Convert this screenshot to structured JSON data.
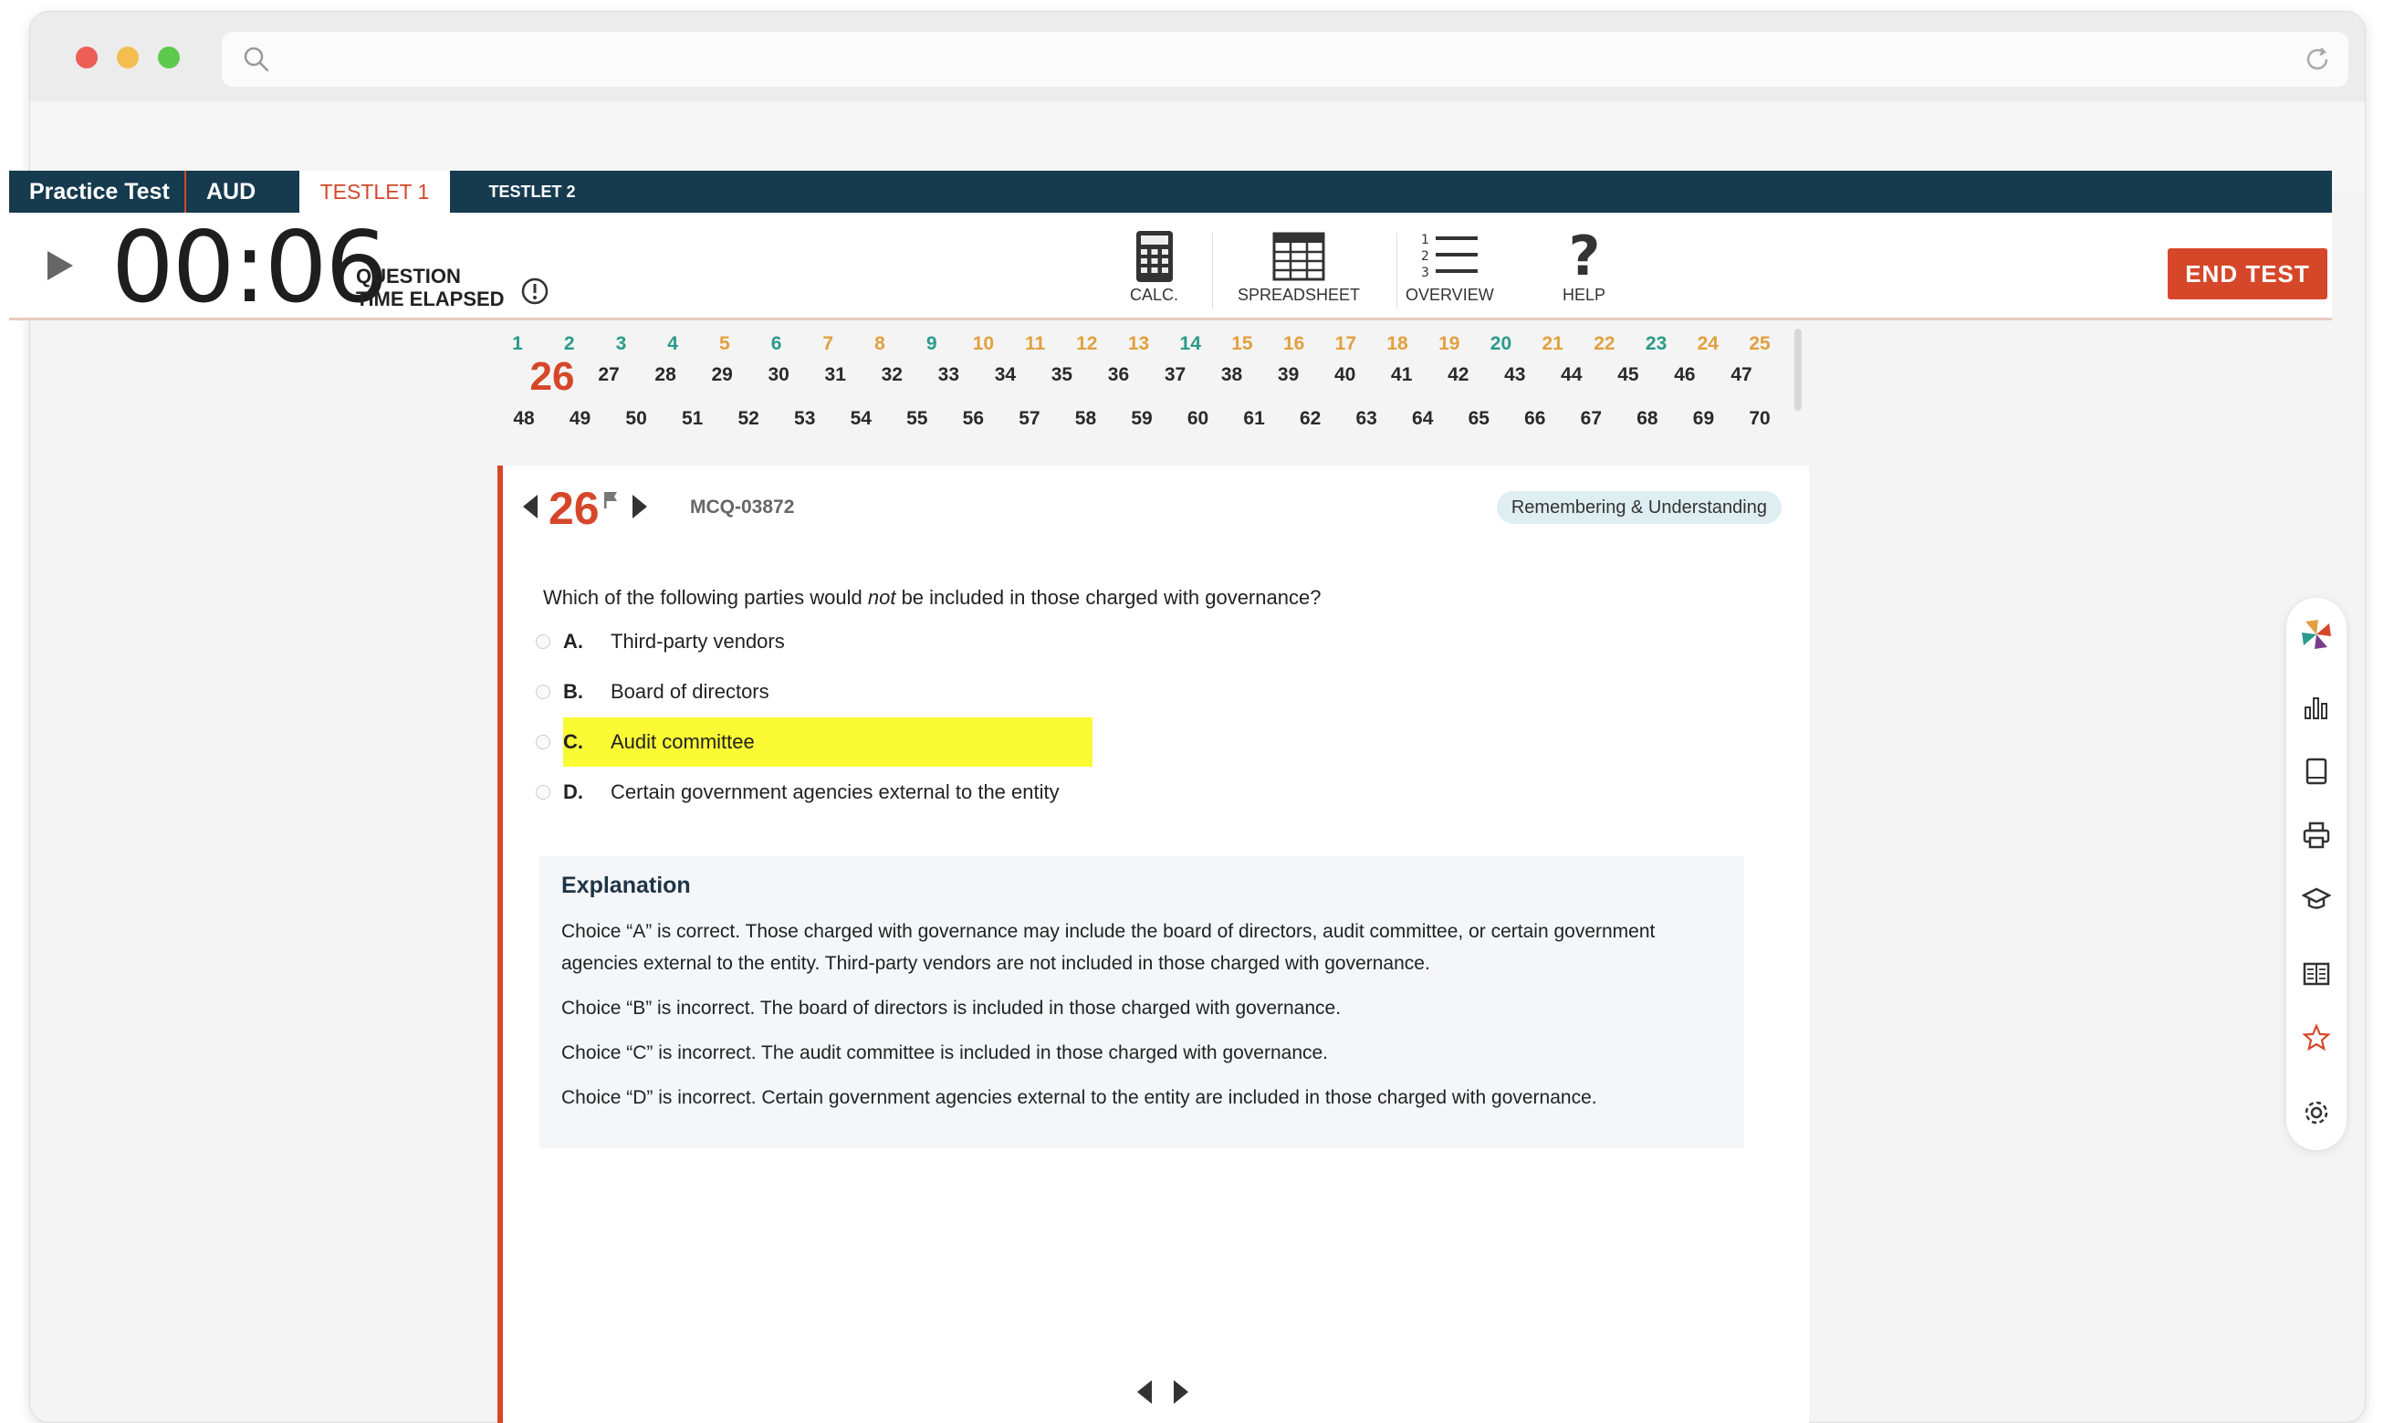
{
  "browser": {
    "traffic_lights": [
      "#ec5f57",
      "#f4bd4f",
      "#5dc94d"
    ],
    "address_value": ""
  },
  "nav": {
    "practice_test": "Practice Test",
    "exam": "AUD",
    "testlet1": "TESTLET 1",
    "testlet2": "TESTLET 2"
  },
  "timer": {
    "value": "00:06",
    "label_line1": "QUESTION",
    "label_line2": "TIME ELAPSED"
  },
  "tools": {
    "calc": "CALC.",
    "spreadsheet": "SPREADSHEET",
    "overview": "OVERVIEW",
    "help": "HELP"
  },
  "end_test": "END TEST",
  "question_grid": {
    "rows": [
      [
        {
          "n": "1",
          "s": "green"
        },
        {
          "n": "2",
          "s": "green"
        },
        {
          "n": "3",
          "s": "green"
        },
        {
          "n": "4",
          "s": "green"
        },
        {
          "n": "5",
          "s": "orange"
        },
        {
          "n": "6",
          "s": "green"
        },
        {
          "n": "7",
          "s": "orange"
        },
        {
          "n": "8",
          "s": "orange"
        },
        {
          "n": "9",
          "s": "green"
        },
        {
          "n": "10",
          "s": "orange"
        },
        {
          "n": "11",
          "s": "orange"
        },
        {
          "n": "12",
          "s": "orange"
        },
        {
          "n": "13",
          "s": "orange"
        },
        {
          "n": "14",
          "s": "green"
        },
        {
          "n": "15",
          "s": "orange"
        },
        {
          "n": "16",
          "s": "orange"
        },
        {
          "n": "17",
          "s": "orange"
        },
        {
          "n": "18",
          "s": "orange"
        },
        {
          "n": "19",
          "s": "orange"
        },
        {
          "n": "20",
          "s": "green"
        },
        {
          "n": "21",
          "s": "orange"
        },
        {
          "n": "22",
          "s": "orange"
        },
        {
          "n": "23",
          "s": "green"
        },
        {
          "n": "24",
          "s": "orange"
        },
        {
          "n": "25",
          "s": "orange"
        }
      ],
      [
        {
          "n": "26",
          "s": "current"
        },
        {
          "n": "27",
          "s": "dark"
        },
        {
          "n": "28",
          "s": "dark"
        },
        {
          "n": "29",
          "s": "dark"
        },
        {
          "n": "30",
          "s": "dark"
        },
        {
          "n": "31",
          "s": "dark"
        },
        {
          "n": "32",
          "s": "dark"
        },
        {
          "n": "33",
          "s": "dark"
        },
        {
          "n": "34",
          "s": "dark"
        },
        {
          "n": "35",
          "s": "dark"
        },
        {
          "n": "36",
          "s": "dark"
        },
        {
          "n": "37",
          "s": "dark"
        },
        {
          "n": "38",
          "s": "dark"
        },
        {
          "n": "39",
          "s": "dark"
        },
        {
          "n": "40",
          "s": "dark"
        },
        {
          "n": "41",
          "s": "dark"
        },
        {
          "n": "42",
          "s": "dark"
        },
        {
          "n": "43",
          "s": "dark"
        },
        {
          "n": "44",
          "s": "dark"
        },
        {
          "n": "45",
          "s": "dark"
        },
        {
          "n": "46",
          "s": "dark"
        },
        {
          "n": "47",
          "s": "dark"
        }
      ],
      [
        {
          "n": "48",
          "s": "dark"
        },
        {
          "n": "49",
          "s": "dark"
        },
        {
          "n": "50",
          "s": "dark"
        },
        {
          "n": "51",
          "s": "dark"
        },
        {
          "n": "52",
          "s": "dark"
        },
        {
          "n": "53",
          "s": "dark"
        },
        {
          "n": "54",
          "s": "dark"
        },
        {
          "n": "55",
          "s": "dark"
        },
        {
          "n": "56",
          "s": "dark"
        },
        {
          "n": "57",
          "s": "dark"
        },
        {
          "n": "58",
          "s": "dark"
        },
        {
          "n": "59",
          "s": "dark"
        },
        {
          "n": "60",
          "s": "dark"
        },
        {
          "n": "61",
          "s": "dark"
        },
        {
          "n": "62",
          "s": "dark"
        },
        {
          "n": "63",
          "s": "dark"
        },
        {
          "n": "64",
          "s": "dark"
        },
        {
          "n": "65",
          "s": "dark"
        },
        {
          "n": "66",
          "s": "dark"
        },
        {
          "n": "67",
          "s": "dark"
        },
        {
          "n": "68",
          "s": "dark"
        },
        {
          "n": "69",
          "s": "dark"
        },
        {
          "n": "70",
          "s": "dark"
        }
      ]
    ]
  },
  "question": {
    "number": "26",
    "id": "MCQ-03872",
    "tag": "Remembering & Understanding",
    "text_before": "Which of the following parties would ",
    "text_emph": "not",
    "text_after": " be included in those charged with governance?",
    "options": [
      {
        "letter": "A.",
        "text": "Third-party vendors",
        "highlighted": false
      },
      {
        "letter": "B.",
        "text": "Board of directors",
        "highlighted": false
      },
      {
        "letter": "C.",
        "text": "Audit committee",
        "highlighted": true
      },
      {
        "letter": "D.",
        "text": "Certain government agencies external to the entity",
        "highlighted": false
      }
    ]
  },
  "explanation": {
    "title": "Explanation",
    "paragraphs": [
      "Choice “A” is correct. Those charged with governance may include the board of directors, audit committee, or certain government agencies external to the entity. Third-party vendors are not included in those charged with governance.",
      "Choice “B” is incorrect. The board of directors is included in those charged with governance.",
      "Choice “C” is incorrect. The audit committee is included in those charged with governance.",
      "Choice “D” is incorrect. Certain government agencies external to the entity are included in those charged with governance."
    ]
  },
  "colors": {
    "accent": "#d6472a",
    "nav_bg": "#163a4e",
    "answered": "#2a9a8a",
    "flagged": "#e2a03f",
    "highlight": "#fafa35"
  },
  "rail_icons": [
    "logo-icon",
    "chart-icon",
    "book-icon",
    "print-icon",
    "graduation-cap-icon",
    "notes-icon",
    "star-icon",
    "gear-icon"
  ]
}
